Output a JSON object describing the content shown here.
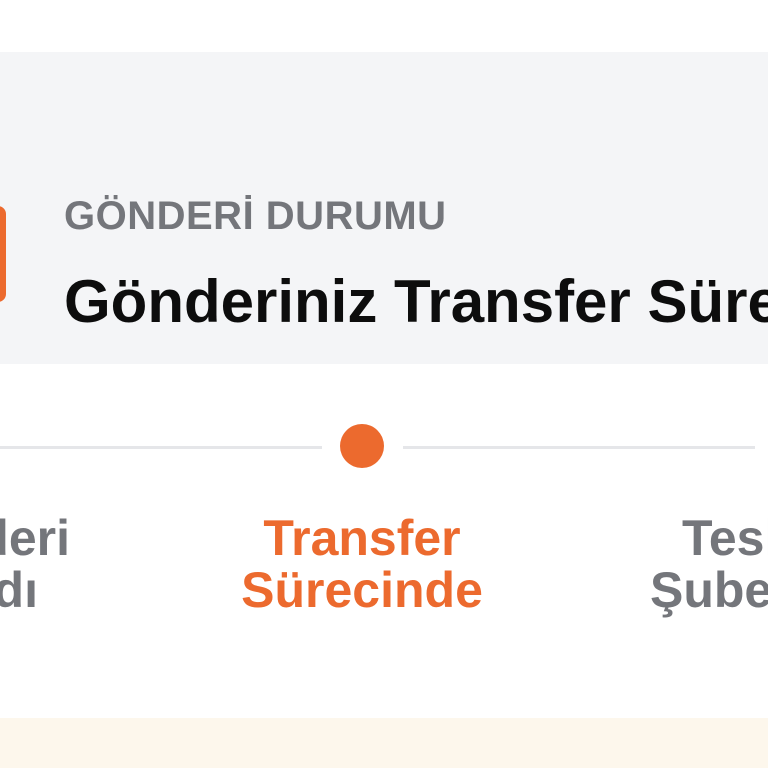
{
  "status": {
    "label": "GÖNDERİ DURUMU",
    "title": "Gönderiniz Transfer Sürecinde",
    "accent_color": "#ec6a2e",
    "icon": "status-icon"
  },
  "steps": [
    {
      "line1": "Gönderi",
      "line2": "Alındı",
      "state": "done"
    },
    {
      "line1": "Transfer",
      "line2": "Sürecinde",
      "state": "active"
    },
    {
      "line1": "Teslimat",
      "line2": "Şubesinde",
      "state": "pending"
    }
  ]
}
